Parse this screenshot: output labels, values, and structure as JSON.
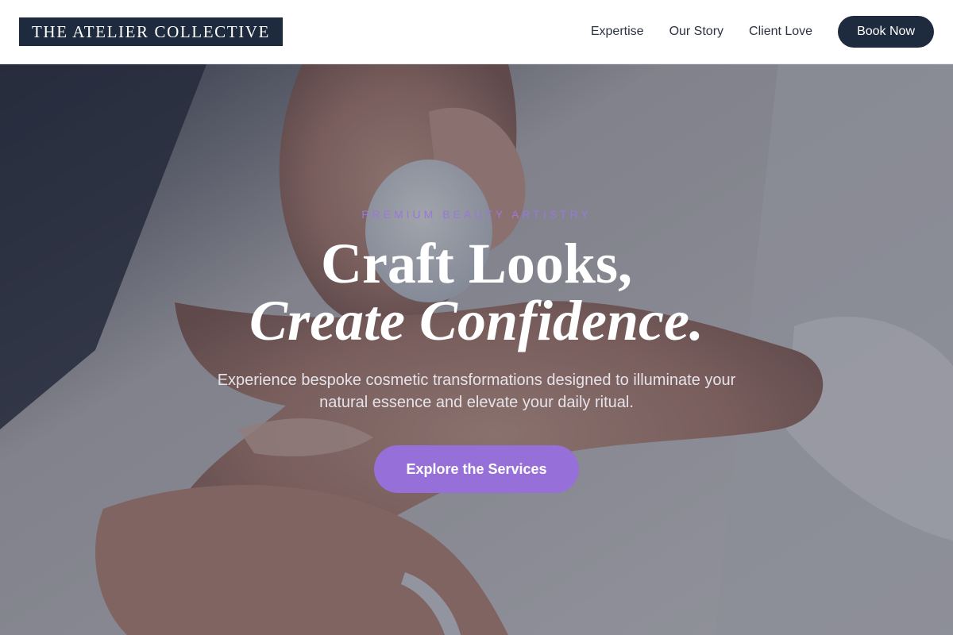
{
  "header": {
    "logo": "THE ATELIER COLLECTIVE",
    "nav": [
      "Expertise",
      "Our Story",
      "Client Love"
    ],
    "cta": "Book Now"
  },
  "hero": {
    "eyebrow": "PREMIUM BEAUTY ARTISTRY",
    "headline_line1": "Craft Looks,",
    "headline_line2": "Create Confidence.",
    "subtitle": "Experience bespoke cosmetic transformations designed to illuminate your natural essence and elevate your daily ritual.",
    "cta": "Explore the Services"
  },
  "colors": {
    "navy": "#1e2a3d",
    "accent_purple": "#9670d8",
    "eyebrow_purple": "#9a78d8"
  }
}
